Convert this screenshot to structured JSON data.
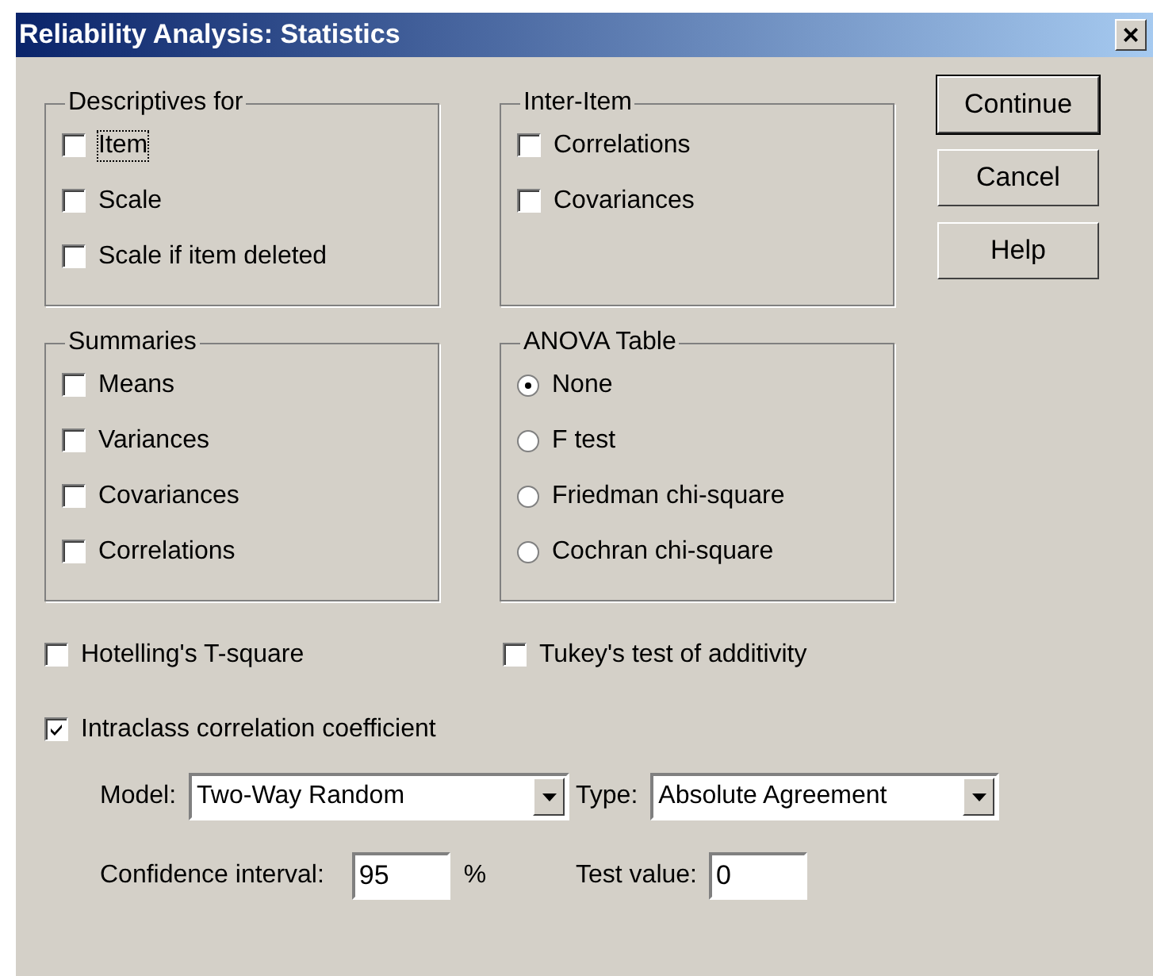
{
  "window": {
    "title": "Reliability Analysis: Statistics",
    "close": "×"
  },
  "descriptives": {
    "title": "Descriptives for",
    "items": [
      {
        "label": "Item",
        "checked": false,
        "focused": true
      },
      {
        "label": "Scale",
        "checked": false,
        "focused": false
      },
      {
        "label": "Scale if item deleted",
        "checked": false,
        "focused": false
      }
    ]
  },
  "inter_item": {
    "title": "Inter-Item",
    "items": [
      {
        "label": "Correlations",
        "checked": false,
        "focused": false
      },
      {
        "label": "Covariances",
        "checked": false,
        "focused": false
      }
    ]
  },
  "buttons": [
    {
      "label": "Continue",
      "default": true
    },
    {
      "label": "Cancel",
      "default": false
    },
    {
      "label": "Help",
      "default": false
    }
  ],
  "summaries": {
    "title": "Summaries",
    "items": [
      {
        "label": "Means",
        "checked": false,
        "focused": false
      },
      {
        "label": "Variances",
        "checked": false,
        "focused": false
      },
      {
        "label": "Covariances",
        "checked": false,
        "focused": false
      },
      {
        "label": "Correlations",
        "checked": false,
        "focused": false
      }
    ]
  },
  "anova": {
    "title": "ANOVA Table",
    "options": [
      {
        "label": "None",
        "selected": true
      },
      {
        "label": "F test",
        "selected": false
      },
      {
        "label": "Friedman chi-square",
        "selected": false
      },
      {
        "label": "Cochran chi-square",
        "selected": false
      }
    ]
  },
  "hotelling": {
    "label": "Hotelling's T-square",
    "checked": false,
    "focused": false
  },
  "tukey": {
    "label": "Tukey's test of additivity",
    "checked": false,
    "focused": false
  },
  "intraclass": {
    "label": "Intraclass correlation coefficient",
    "checked": true,
    "focused": false
  },
  "model": {
    "label": "Model:",
    "value": "Two-Way Random"
  },
  "type": {
    "label": "Type:",
    "value": "Absolute Agreement"
  },
  "confidence": {
    "label": "Confidence interval:",
    "value": "95",
    "unit": "%"
  },
  "test_value": {
    "label": "Test value:",
    "value": "0"
  }
}
